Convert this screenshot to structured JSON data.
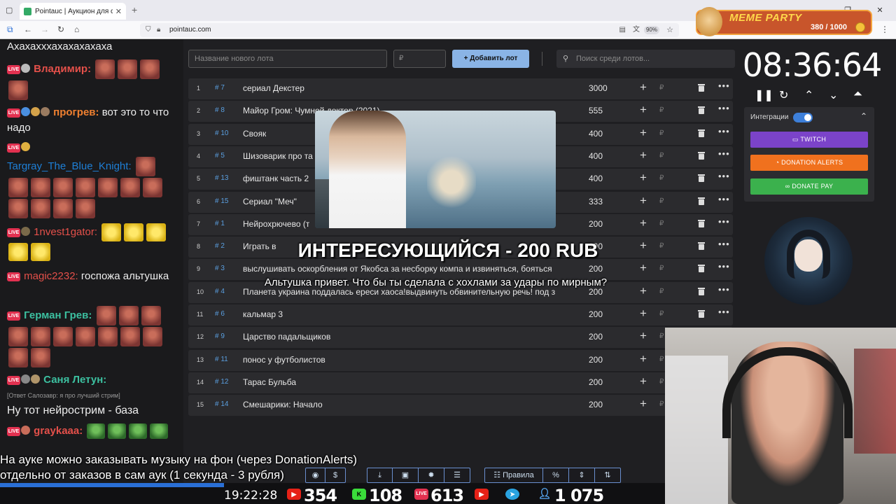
{
  "browser": {
    "tab_title": "Pointauc | Аукцион для стрим",
    "url": "pointauc.com",
    "zoom": "90%"
  },
  "meme_party": {
    "title": "MEME PARTY",
    "count": "380 / 1000"
  },
  "chat": {
    "messages": [
      {
        "text": "Ахахахххахахахахаха"
      },
      {
        "nick": "Владимир:",
        "nick_color": "#e4504a"
      },
      {
        "nick": "прогрев:",
        "nick_color": "#f08030",
        "text": "вот это то что надо"
      },
      {
        "nick": "Targray_The_Blue_Knight:",
        "nick_color": "#1e7fd6"
      },
      {
        "nick": "1nvest1gator:",
        "nick_color": "#e4504a"
      },
      {
        "nick": "magic2232:",
        "nick_color": "#e4504a",
        "text": "госпожа альтушка"
      },
      {
        "nick": "Герман Грев:",
        "nick_color": "#3cc0a0"
      },
      {
        "nick": "Саня Летун:",
        "nick_color": "#3cc0a0"
      },
      {
        "reply": "[Ответ Салозавр: я про лучший стрим]",
        "text": "Ну тот нейрострим - база"
      },
      {
        "nick": "graykaaa:",
        "nick_color": "#e4504a"
      }
    ]
  },
  "add_form": {
    "lot_placeholder": "Название нового лота",
    "price_placeholder": "₽",
    "add_label": "Добавить лот",
    "search_placeholder": "Поиск среди лотов..."
  },
  "lots": [
    {
      "idx": "1",
      "num": "# 7",
      "name": "сериал Декстер",
      "amount": "3000"
    },
    {
      "idx": "2",
      "num": "# 8",
      "name": "Майор Гром: Чумной доктор (2021)",
      "amount": "555"
    },
    {
      "idx": "3",
      "num": "# 10",
      "name": "Свояк",
      "amount": "400"
    },
    {
      "idx": "4",
      "num": "# 5",
      "name": "Шизоварик про та",
      "amount": "400"
    },
    {
      "idx": "5",
      "num": "# 13",
      "name": "фиштанк часть 2",
      "amount": "400"
    },
    {
      "idx": "6",
      "num": "# 15",
      "name": "Сериал \"Меч\"",
      "amount": "333"
    },
    {
      "idx": "7",
      "num": "# 1",
      "name": "Нейрохрючево (т",
      "amount": "200"
    },
    {
      "idx": "8",
      "num": "# 2",
      "name": "Играть в ",
      "amount": "200"
    },
    {
      "idx": "9",
      "num": "# 3",
      "name": "выслушивать оскорбления от Якобса за несборку компа и извиняться, бояться",
      "amount": "200"
    },
    {
      "idx": "10",
      "num": "# 4",
      "name": "Планета украина поддалась ереси хаоса!выдвинуть обвинительную речь! под з",
      "amount": "200"
    },
    {
      "idx": "11",
      "num": "# 6",
      "name": "кальмар 3",
      "amount": "200"
    },
    {
      "idx": "12",
      "num": "# 9",
      "name": "Царство падальщиков",
      "amount": "200"
    },
    {
      "idx": "13",
      "num": "# 11",
      "name": "понос у футболистов",
      "amount": "200"
    },
    {
      "idx": "14",
      "num": "# 12",
      "name": "Тарас Бульба",
      "amount": "200"
    },
    {
      "idx": "15",
      "num": "# 14",
      "name": "Смешарики: Начало",
      "amount": "200"
    }
  ],
  "alert": {
    "title": "ИНТЕРЕСУЮЩИЙСЯ - 200 RUB",
    "message": "Альтушка привет. Что бы ты сделала с хохлами за удары по мирным?"
  },
  "timer": {
    "value": "08:36:64"
  },
  "integrations": {
    "label": "Интеграции",
    "twitch": "TWITCH",
    "donation_alerts": "DONATION ALERTS",
    "donate_pay": "DONATE PAY"
  },
  "footer": {
    "line1": "На ауке можно заказывать музыку на фон (через DonationAlerts)",
    "line2": "отдельно от заказов в сам аук (1 секунда - 3 рубля)",
    "rules_label": "Правила"
  },
  "status": {
    "clock": "19:22:28",
    "youtube": "354",
    "kick": "108",
    "vk": "613",
    "telegram": "1 075"
  }
}
